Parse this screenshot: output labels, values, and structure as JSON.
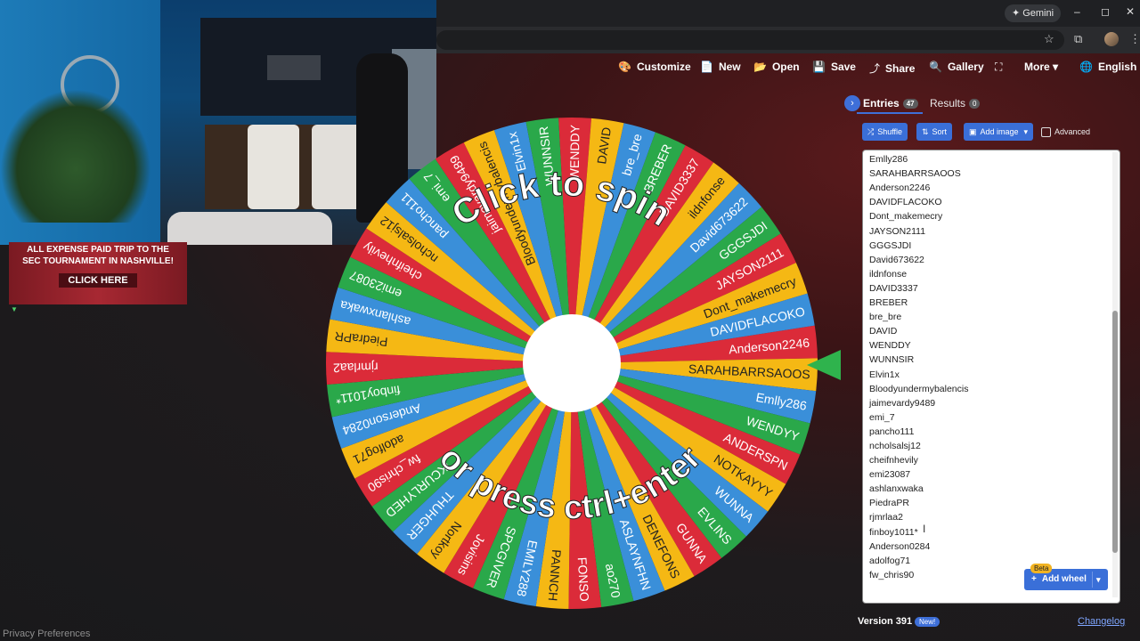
{
  "browser": {
    "gemini_label": "Gemini",
    "window_controls": [
      "–",
      "◻",
      "✕"
    ]
  },
  "toolbar": {
    "items": [
      {
        "icon": "🎨",
        "label": "Customize"
      },
      {
        "icon": "📄",
        "label": "New"
      },
      {
        "icon": "📂",
        "label": "Open"
      },
      {
        "icon": "💾",
        "label": "Save"
      },
      {
        "icon": "⤴",
        "label": "Share"
      },
      {
        "icon": "🔍",
        "label": "Gallery"
      },
      {
        "icon": "⛶",
        "label": ""
      },
      {
        "icon": "",
        "label": "More ▾"
      },
      {
        "icon": "🌐",
        "label": "English"
      }
    ]
  },
  "ad": {
    "line1": "ALL EXPENSE PAID TRIP TO THE",
    "line2": "SEC TOURNAMENT IN NASHVILLE!",
    "button": "CLICK HERE"
  },
  "wheel": {
    "top_text": "Click to spin",
    "bottom_text": "or press ctrl+enter",
    "colors": [
      "#db2b39",
      "#f5b814",
      "#3a8fd9",
      "#2aa84a"
    ],
    "segments": [
      "Anderson2246",
      "SARAHBARRSAOOS",
      "Emlly286",
      "WENDYY",
      "ANDERSPN",
      "NOTKAYYY",
      "WUNNA",
      "EVLINS",
      "GUNNA",
      "DENEFONS",
      "ASLAYNFHN",
      "ao270",
      "FONSO",
      "PANNCH",
      "EMILY288",
      "SPCGIVER",
      "Jovisins",
      "Nortkoy",
      "THUHGER",
      "IKCURLYHED",
      "fw_chris90",
      "adolfog71",
      "Anderson0284",
      "finboy1011*",
      "rjmrlaa2",
      "PiedraPR",
      "ashlanxwaka",
      "emi23087",
      "cheifnhevily",
      "ncholsalsj12",
      "pancho111",
      "emi_7",
      "jaimevardy9489",
      "Bloodyundermybalencis",
      "Elvin1x",
      "WUNNSIR",
      "WENDDY",
      "DAVID",
      "bre_bre",
      "BREBER",
      "DAVID3337",
      "ildnfonse",
      "David673622",
      "GGGSJDI",
      "JAYSON2111",
      "Dont_makemecry",
      "DAVIDFLACOKO"
    ]
  },
  "privacy": "Privacy Preferences",
  "panel": {
    "tab_entries": "Entries",
    "entries_count": "47",
    "tab_results": "Results",
    "results_count": "0",
    "shuffle": "Shuffle",
    "sort": "Sort",
    "add_image": "Add image",
    "advanced": "Advanced",
    "entries": [
      "WENDYY",
      "Emlly286",
      "SARAHBARRSAOOS",
      "Anderson2246",
      "DAVIDFLACOKO",
      "Dont_makemecry",
      "JAYSON2111",
      "GGGSJDI",
      "David673622",
      "ildnfonse",
      "DAVID3337",
      "BREBER",
      "bre_bre",
      "DAVID",
      "WENDDY",
      "WUNNSIR",
      "Elvin1x",
      "Bloodyundermybalencis",
      "jaimevardy9489",
      "emi_7",
      "pancho111",
      "ncholsalsj12",
      "cheifnhevily",
      "emi23087",
      "ashlanxwaka",
      "PiedraPR",
      "rjmrlaa2",
      "finboy1011*",
      "Anderson0284",
      "adolfog71",
      "fw_chris90"
    ],
    "beta": "Beta",
    "add_wheel": "Add wheel",
    "version": "Version 391",
    "new_badge": "New!",
    "changelog": "Changelog"
  }
}
